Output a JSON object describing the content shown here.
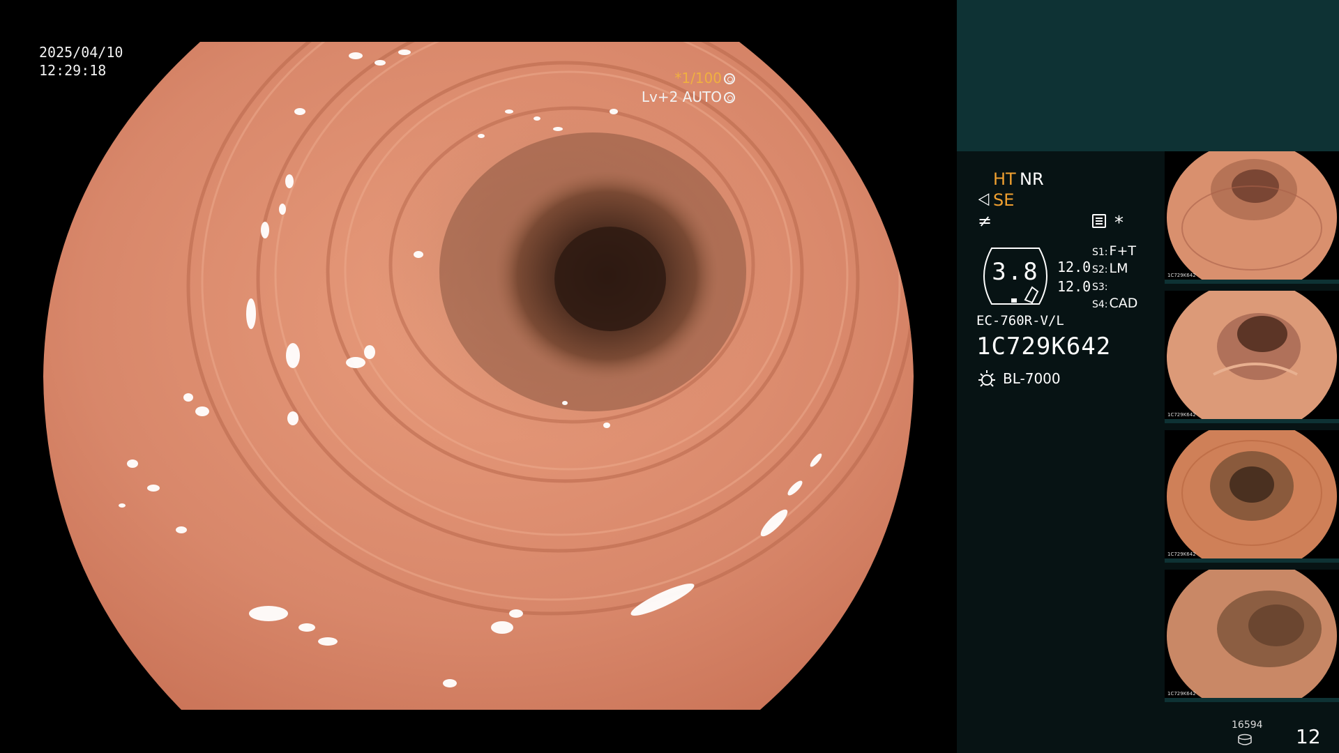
{
  "overlay": {
    "date": "2025/04/10",
    "time": "12:29:18",
    "shutter": "*1/100",
    "level": "Lv+2 AUTO"
  },
  "info_panel": {
    "ht_label": "HT",
    "nr_label": "NR",
    "se_label": "SE",
    "se_icon": "enhance-icon",
    "slash_icon": "function-icon",
    "menu_icon": "settings-menu-icon",
    "star_symbol": "*",
    "zoom_value": "3.8",
    "value_a": "12.0",
    "value_b": "12.0",
    "switches": [
      {
        "key": "S1:",
        "value": "F+T"
      },
      {
        "key": "S2:",
        "value": "LM"
      },
      {
        "key": "S3:",
        "value": ""
      },
      {
        "key": "S4:",
        "value": "CAD"
      }
    ],
    "scope_model": "EC-760R-V/L",
    "scope_serial": "1C729K642",
    "lamp_icon": "light-source-icon",
    "lamp_label": "BL-7000"
  },
  "thumbnails": [
    {
      "label": "1C729K642"
    },
    {
      "label": "1C729K642"
    },
    {
      "label": "1C729K642"
    },
    {
      "label": "1C729K642"
    }
  ],
  "footer": {
    "frame_count": "16594",
    "storage_icon": "storage-icon",
    "page_number": "12"
  },
  "colors": {
    "tissue": "#d8876a",
    "lumen": "#3a2218",
    "accent_orange": "#f0a030",
    "panel_teal": "#0e3234",
    "panel_dark": "#071314"
  }
}
